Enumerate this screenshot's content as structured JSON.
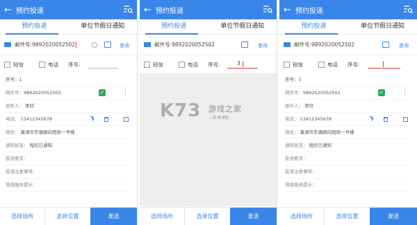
{
  "app": {
    "title": "预约投递",
    "tab_booking": "预约投递",
    "tab_holiday": "单位节假日通知"
  },
  "screens": [
    {
      "mail_label": "邮件号:",
      "mail_value": "9892020052502",
      "query": "查询",
      "sms": "短信",
      "phone": "电话",
      "seq_label": "序号:",
      "seq_value": ""
    },
    {
      "mail_label": "邮件号:",
      "mail_value": "9892020052502",
      "query": "查询",
      "sms": "短信",
      "phone": "电话",
      "seq_label": "序号:",
      "seq_value": "3"
    },
    {
      "mail_label": "邮件号:",
      "mail_value": "9892020052502",
      "query": "查询",
      "sms": "短信",
      "phone": "电话",
      "seq_label": "序号:",
      "seq_value": ""
    }
  ],
  "detail": [
    {
      "seq": "序号：1",
      "mail": "邮件号：",
      "mail_no": "9892020052502",
      "receiver": "收件人：",
      "receiver_name": "李欣",
      "phone": "电话：",
      "phone_no": "13412345678",
      "addr": "地址：",
      "addr_val": "巢湖市东塘路向阳局一号楼",
      "notify": "通知状态：",
      "notify_val": "短信已通知",
      "req": "投递要求：",
      "notes": "投递注意事项：",
      "service": "增值服务提示："
    },
    {
      "seq": "序号：3",
      "mail": "邮件号：",
      "mail_no": "9892020052502",
      "receiver": "收件人：",
      "receiver_name": "李欣",
      "phone": "电话：",
      "phone_no": "13412345678",
      "addr": "地址：",
      "addr_val": "巢湖市东塘路向阳局一号楼",
      "notify": "通知状态：",
      "notify_val": "短信已通知",
      "req": "投递要求：",
      "notes": "投递注意事项：",
      "service": "增值服务提示："
    }
  ],
  "bottom": {
    "place": "选择场所",
    "position": "选择位置",
    "send": "发送"
  },
  "watermark": {
    "logo": "K73",
    "cn": "游戏之家",
    "domain": ".com"
  },
  "colors": {
    "accent": "#3a86e8",
    "check": "#2eaa55",
    "cursor": "#e53935"
  }
}
